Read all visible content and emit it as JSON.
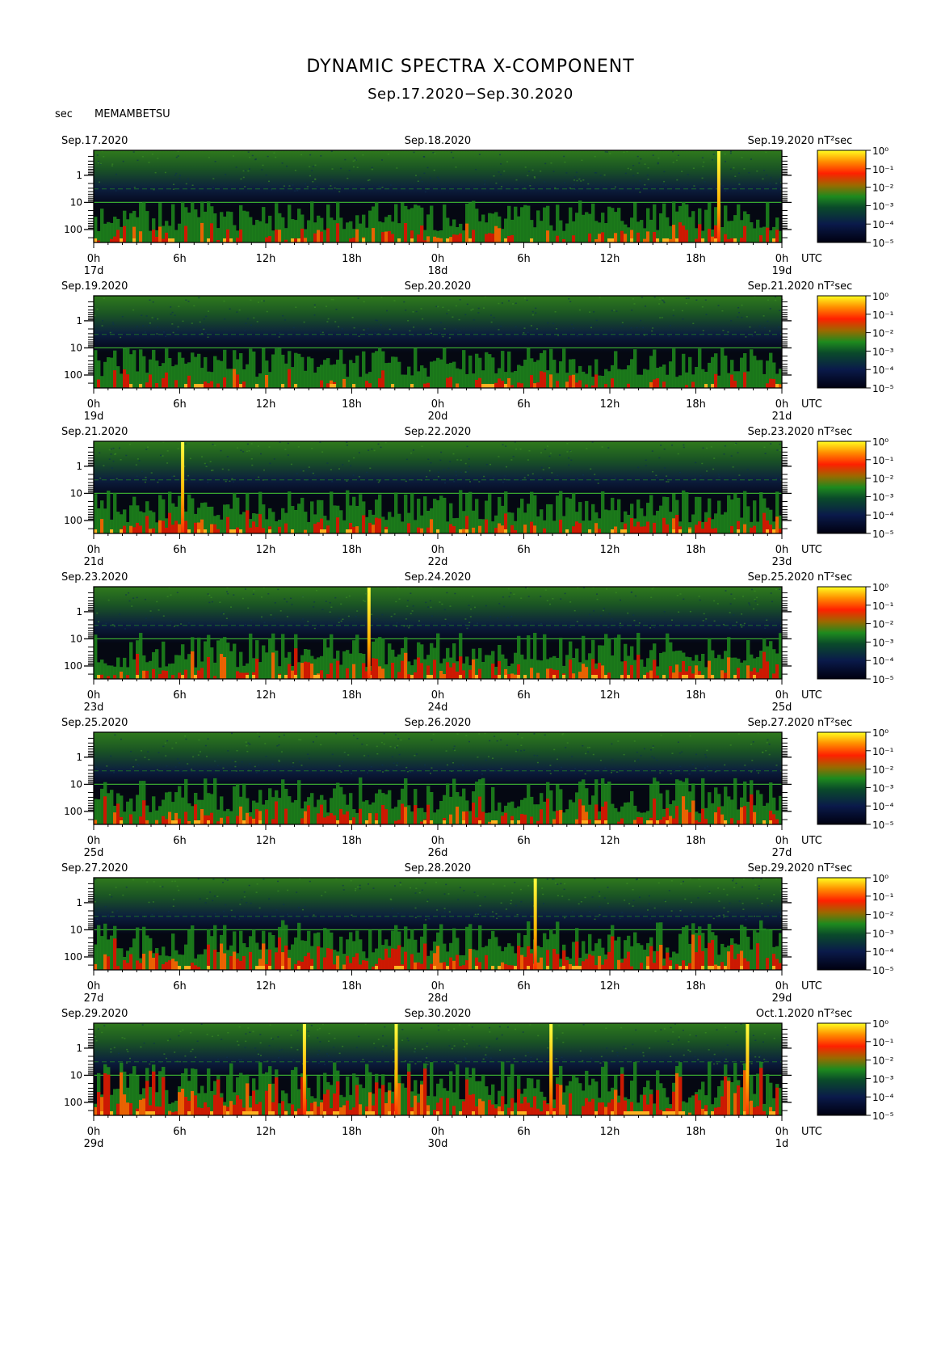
{
  "title": "DYNAMIC SPECTRA X-COMPONENT",
  "subtitle": "Sep.17.2020−Sep.30.2020",
  "station": "MEMAMBETSU",
  "yunit": "sec",
  "timezone": "UTC",
  "colorbar_unit": "nT²sec",
  "chart_data": {
    "type": "heatmap",
    "y_axis": {
      "label": "sec",
      "scale": "log",
      "ticks": [
        1,
        10,
        100
      ]
    },
    "x_axis": {
      "ticks": [
        "0h",
        "6h",
        "12h",
        "18h",
        "0h",
        "6h",
        "12h",
        "18h",
        "0h"
      ],
      "unit": "UTC"
    },
    "colorbar": {
      "unit": "nT²sec",
      "scale": "log",
      "ticks": [
        "10⁰",
        "10⁻¹",
        "10⁻²",
        "10⁻³",
        "10⁻⁴",
        "10⁻⁵"
      ],
      "colors": [
        "#ffff00",
        "#ff8000",
        "#ff0000",
        "#008000",
        "#003050",
        "#000010"
      ]
    },
    "panels": [
      {
        "left_date": "Sep.17.2020",
        "mid_date": "Sep.18.2020",
        "right_date": "Sep.19.2020",
        "day_labels": [
          "17d",
          "18d",
          "19d"
        ],
        "spikes_h": [
          43.6
        ],
        "activity": 0.45
      },
      {
        "left_date": "Sep.19.2020",
        "mid_date": "Sep.20.2020",
        "right_date": "Sep.21.2020",
        "day_labels": [
          "19d",
          "20d",
          "21d"
        ],
        "spikes_h": [],
        "activity": 0.4
      },
      {
        "left_date": "Sep.21.2020",
        "mid_date": "Sep.22.2020",
        "right_date": "Sep.23.2020",
        "day_labels": [
          "21d",
          "22d",
          "23d"
        ],
        "spikes_h": [
          6.2
        ],
        "activity": 0.5
      },
      {
        "left_date": "Sep.23.2020",
        "mid_date": "Sep.24.2020",
        "right_date": "Sep.25.2020",
        "day_labels": [
          "23d",
          "24d",
          "25d"
        ],
        "spikes_h": [
          19.2
        ],
        "activity": 0.6
      },
      {
        "left_date": "Sep.25.2020",
        "mid_date": "Sep.26.2020",
        "right_date": "Sep.27.2020",
        "day_labels": [
          "25d",
          "26d",
          "27d"
        ],
        "spikes_h": [],
        "activity": 0.62
      },
      {
        "left_date": "Sep.27.2020",
        "mid_date": "Sep.28.2020",
        "right_date": "Sep.29.2020",
        "day_labels": [
          "27d",
          "28d",
          "29d"
        ],
        "spikes_h": [
          30.8
        ],
        "activity": 0.72
      },
      {
        "left_date": "Sep.29.2020",
        "mid_date": "Sep.30.2020",
        "right_date": "Oct.1.2020",
        "day_labels": [
          "29d",
          "30d",
          "1d"
        ],
        "spikes_h": [
          14.7,
          21.1,
          31.9,
          45.6
        ],
        "activity": 0.85
      }
    ]
  }
}
